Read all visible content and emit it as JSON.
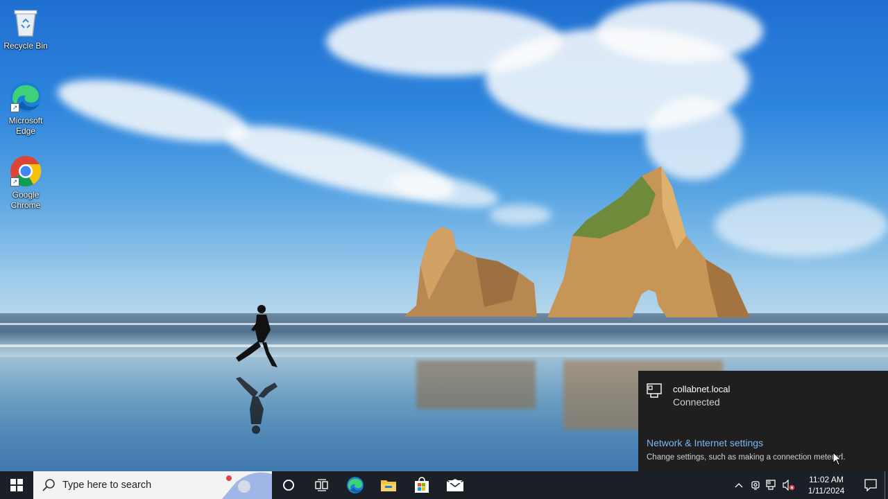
{
  "desktop_icons": [
    {
      "label": "Recycle Bin",
      "icon": "recycle-bin-icon"
    },
    {
      "label": "Microsoft Edge",
      "icon": "edge-icon"
    },
    {
      "label": "Google Chrome",
      "icon": "chrome-icon"
    }
  ],
  "network_flyout": {
    "network_name": "collabnet.local",
    "status": "Connected",
    "settings_link": "Network & Internet settings",
    "settings_description": "Change settings, such as making a connection metered."
  },
  "taskbar": {
    "search_placeholder": "Type here to search",
    "pinned_apps": [
      "cortana-icon",
      "task-view-icon",
      "edge-icon",
      "file-explorer-icon",
      "microsoft-store-icon",
      "mail-icon"
    ],
    "tray_icons": [
      "show-hidden-icons-chevron",
      "meet-now-icon",
      "network-icon",
      "volume-muted-icon"
    ],
    "clock": {
      "time": "11:02 AM",
      "date": "1/11/2024"
    }
  },
  "colors": {
    "taskbar": "#1b2027",
    "flyout": "#1f1f1f",
    "link": "#7cb8f2",
    "windows_logo": "#ffffff"
  }
}
